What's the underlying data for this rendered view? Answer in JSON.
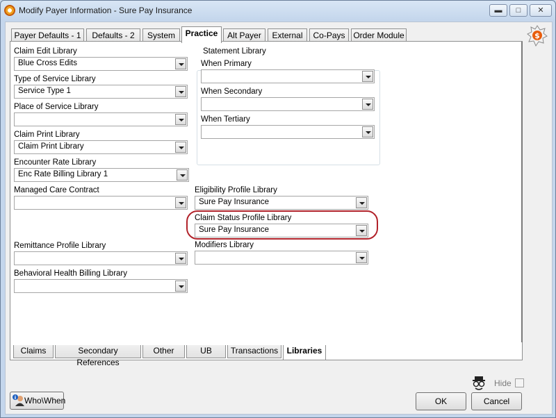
{
  "window": {
    "title": "Modify Payer Information - Sure Pay Insurance",
    "minimize": "▬",
    "maximize": "□",
    "close": "✕"
  },
  "top_tabs": [
    {
      "label": "Payer Defaults - 1"
    },
    {
      "label": "Defaults - 2"
    },
    {
      "label": "System"
    },
    {
      "label": "Practice"
    },
    {
      "label": "Alt Payer"
    },
    {
      "label": "External"
    },
    {
      "label": "Co-Pays"
    },
    {
      "label": "Order Module"
    }
  ],
  "active_top_tab": "Practice",
  "left_fields": [
    {
      "label": "Claim Edit Library",
      "value": "Blue Cross Edits"
    },
    {
      "label": "Type of Service Library",
      "value": "Service Type 1"
    },
    {
      "label": "Place of Service Library",
      "value": ""
    },
    {
      "label": "Claim Print Library",
      "value": "Claim Print Library"
    },
    {
      "label": "Encounter Rate Library",
      "value": "Enc Rate Billing Library 1"
    },
    {
      "label": "Managed Care Contract",
      "value": ""
    },
    {
      "label": "Remittance Profile Library",
      "value": ""
    },
    {
      "label": "Behavioral Health Billing Library",
      "value": ""
    }
  ],
  "statement_library": {
    "title": "Statement Library",
    "fields": [
      {
        "label": "When Primary",
        "value": ""
      },
      {
        "label": "When Secondary",
        "value": ""
      },
      {
        "label": "When Tertiary",
        "value": ""
      }
    ]
  },
  "right_fields": [
    {
      "label": "Eligibility Profile Library",
      "value": "Sure Pay Insurance"
    },
    {
      "label": "Claim Status Profile Library",
      "value": "Sure Pay Insurance"
    },
    {
      "label": "Modifiers Library",
      "value": ""
    }
  ],
  "bottom_tabs": [
    {
      "label": "Claims"
    },
    {
      "label": "Secondary References"
    },
    {
      "label": "Other"
    },
    {
      "label": "UB"
    },
    {
      "label": "Transactions"
    },
    {
      "label": "Libraries"
    }
  ],
  "active_bottom_tab": "Libraries",
  "footer": {
    "who_when": "Who\\When",
    "hide_label": "Hide",
    "hide_checked": false,
    "ok": "OK",
    "cancel": "Cancel"
  },
  "colors": {
    "highlight_ring": "#b1222a",
    "title_bar": "#c4d6ec"
  }
}
